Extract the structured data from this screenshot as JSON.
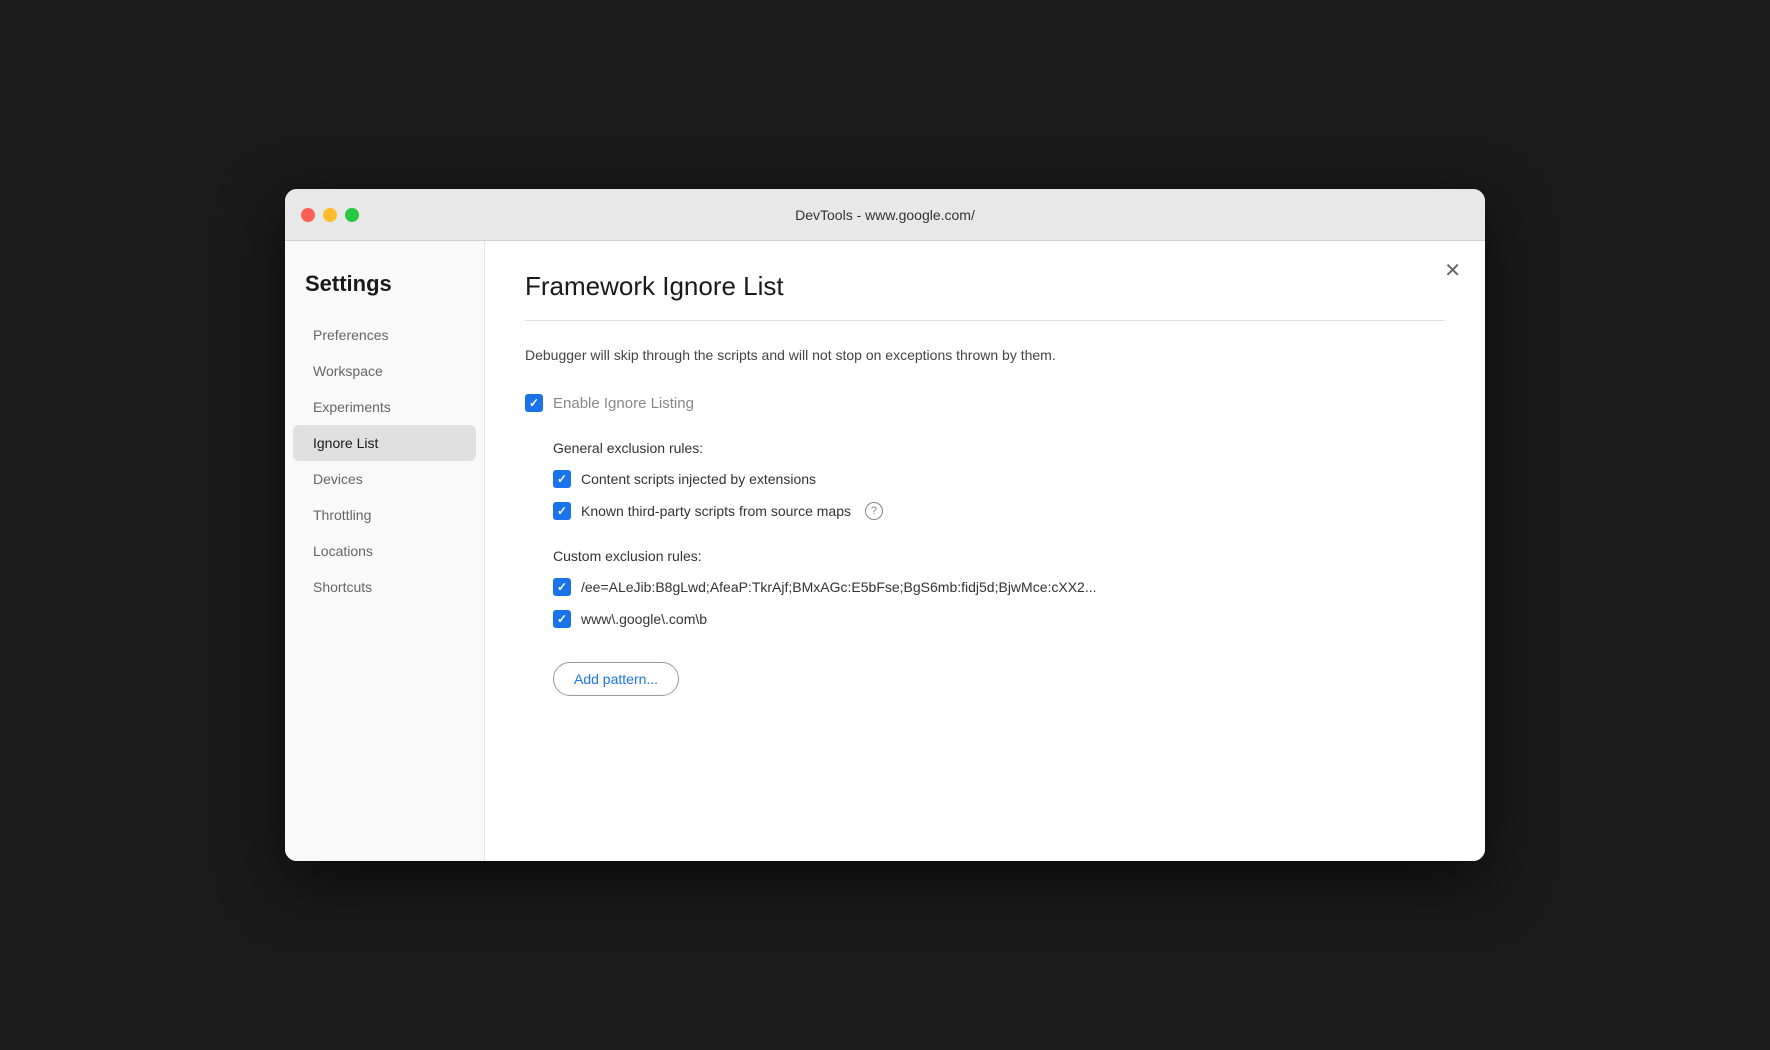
{
  "window": {
    "title": "DevTools - www.google.com/"
  },
  "titlebar": {
    "close_label": "",
    "minimize_label": "",
    "maximize_label": ""
  },
  "sidebar": {
    "title": "Settings",
    "items": [
      {
        "id": "preferences",
        "label": "Preferences",
        "active": false
      },
      {
        "id": "workspace",
        "label": "Workspace",
        "active": false
      },
      {
        "id": "experiments",
        "label": "Experiments",
        "active": false
      },
      {
        "id": "ignore-list",
        "label": "Ignore List",
        "active": true
      },
      {
        "id": "devices",
        "label": "Devices",
        "active": false
      },
      {
        "id": "throttling",
        "label": "Throttling",
        "active": false
      },
      {
        "id": "locations",
        "label": "Locations",
        "active": false
      },
      {
        "id": "shortcuts",
        "label": "Shortcuts",
        "active": false
      }
    ]
  },
  "main": {
    "title": "Framework Ignore List",
    "description": "Debugger will skip through the scripts and will not stop on exceptions thrown by them.",
    "enable_label": "Enable Ignore Listing",
    "general_section_label": "General exclusion rules:",
    "rules": [
      {
        "id": "content-scripts",
        "text": "Content scripts injected by extensions",
        "checked": true,
        "has_info": false
      },
      {
        "id": "third-party-scripts",
        "text": "Known third-party scripts from source maps",
        "checked": true,
        "has_info": true
      }
    ],
    "custom_section_label": "Custom exclusion rules:",
    "custom_rules": [
      {
        "id": "custom-rule-1",
        "text": "/ee=ALeJib:B8gLwd;AfeaP:TkrAjf;BMxAGc:E5bFse;BgS6mb:fidj5d;BjwMce:cXX2...",
        "checked": true
      },
      {
        "id": "custom-rule-2",
        "text": "www\\.google\\.com\\b",
        "checked": true
      }
    ],
    "add_pattern_label": "Add pattern...",
    "close_icon": "✕"
  }
}
